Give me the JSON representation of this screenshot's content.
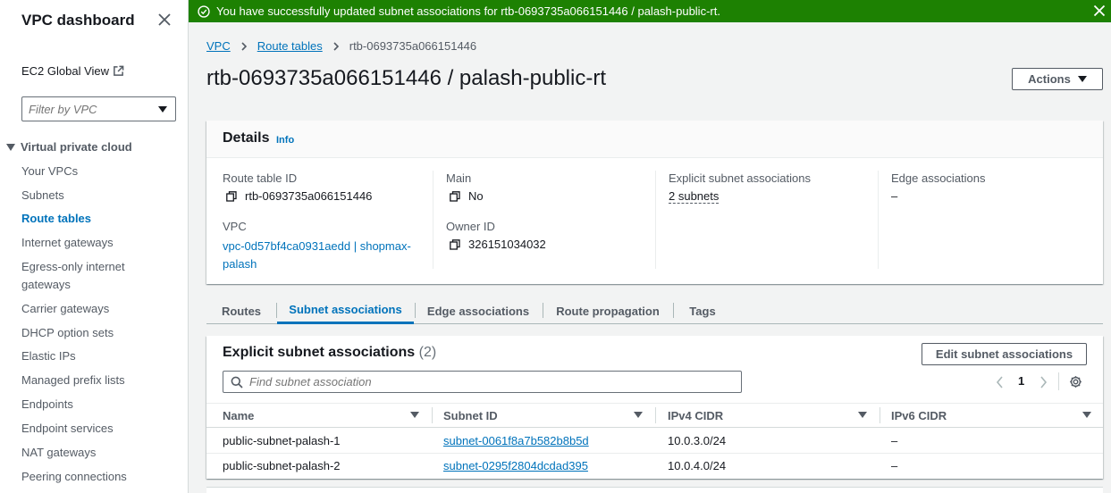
{
  "sidebar": {
    "title": "VPC dashboard",
    "ec2_global_view": "EC2 Global View",
    "filter_placeholder": "Filter by VPC",
    "section": "Virtual private cloud",
    "items": [
      {
        "label": "Your VPCs"
      },
      {
        "label": "Subnets"
      },
      {
        "label": "Route tables"
      },
      {
        "label": "Internet gateways"
      },
      {
        "label": "Egress-only internet gateways"
      },
      {
        "label": "Carrier gateways"
      },
      {
        "label": "DHCP option sets"
      },
      {
        "label": "Elastic IPs"
      },
      {
        "label": "Managed prefix lists"
      },
      {
        "label": "Endpoints"
      },
      {
        "label": "Endpoint services"
      },
      {
        "label": "NAT gateways"
      },
      {
        "label": "Peering connections"
      }
    ],
    "active_item": "Route tables"
  },
  "flash": {
    "message": "You have successfully updated subnet associations for rtb-0693735a066151446 / palash-public-rt.",
    "color": "#1d8102"
  },
  "breadcrumb": {
    "items": [
      "VPC",
      "Route tables"
    ],
    "current": "rtb-0693735a066151446"
  },
  "page": {
    "title": "rtb-0693735a066151446 / palash-public-rt",
    "actions_label": "Actions"
  },
  "details": {
    "heading": "Details",
    "info": "Info",
    "route_table_id_label": "Route table ID",
    "route_table_id": "rtb-0693735a066151446",
    "vpc_label": "VPC",
    "vpc_line1": "vpc-0d57bf4ca0931aedd | shopmax-",
    "vpc_line2": "palash",
    "main_label": "Main",
    "main_value": "No",
    "owner_label": "Owner ID",
    "owner_value": "326151034032",
    "explicit_label": "Explicit subnet associations",
    "explicit_value": "2 subnets",
    "edge_label": "Edge associations",
    "edge_value": "–"
  },
  "tabs": [
    {
      "label": "Routes"
    },
    {
      "label": "Subnet associations"
    },
    {
      "label": "Edge associations"
    },
    {
      "label": "Route propagation"
    },
    {
      "label": "Tags"
    }
  ],
  "active_tab": "Subnet associations",
  "associations": {
    "heading": "Explicit subnet associations",
    "count": "(2)",
    "edit_label": "Edit subnet associations",
    "search_placeholder": "Find subnet association",
    "page_number": "1",
    "columns": [
      "Name",
      "Subnet ID",
      "IPv4 CIDR",
      "IPv6 CIDR"
    ],
    "rows": [
      {
        "name": "public-subnet-palash-1",
        "subnet_id": "subnet-0061f8a7b582b8b5d",
        "ipv4": "10.0.3.0/24",
        "ipv6": "–"
      },
      {
        "name": "public-subnet-palash-2",
        "subnet_id": "subnet-0295f2804dcdad395",
        "ipv4": "10.0.4.0/24",
        "ipv6": "–"
      }
    ]
  },
  "colors": {
    "link": "#0073bb",
    "success": "#1d8102"
  }
}
